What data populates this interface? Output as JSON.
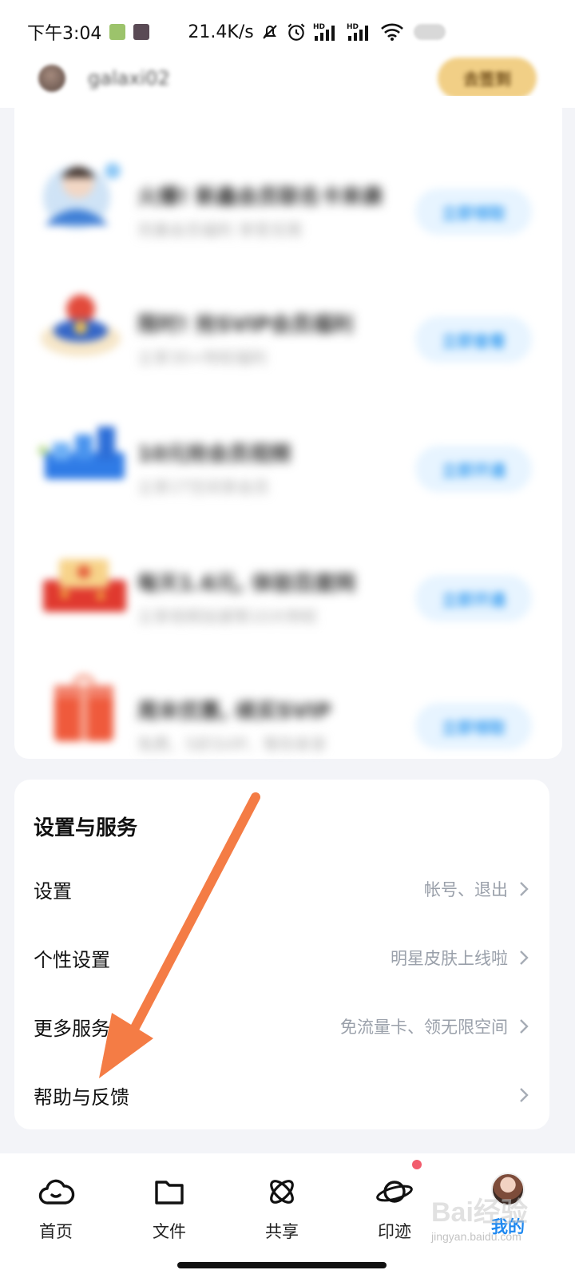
{
  "status_bar": {
    "time": "下午3:04",
    "net_speed": "21.4K/s"
  },
  "profile": {
    "username": "galaxi02",
    "sign_in_button": "去签到"
  },
  "promos": [
    {
      "title": "火爆! 新鑫会员联名卡来袭",
      "subtitle": "完善会员福利 享受无限",
      "button": "立即领取"
    },
    {
      "title": "限时! 抢SVIP会员福利",
      "subtitle": "立享30+特权福利",
      "button": "立即查看"
    },
    {
      "title": "10元抢会员视频",
      "subtitle": "立享1T空间享会员",
      "button": "立即开通"
    },
    {
      "title": "每天1.6元, 体验百度网",
      "subtitle": "立享视频加速等10大特权",
      "button": "立即开通"
    },
    {
      "title": "周末优惠, 续买SVIP",
      "subtitle": "免费、5折SVIP、等你来享",
      "button": "立即领取"
    }
  ],
  "settings": {
    "title": "设置与服务",
    "rows": [
      {
        "label": "设置",
        "hint": "帐号、退出"
      },
      {
        "label": "个性设置",
        "hint": "明星皮肤上线啦"
      },
      {
        "label": "更多服务",
        "hint": "免流量卡、领无限空间"
      },
      {
        "label": "帮助与反馈",
        "hint": ""
      }
    ]
  },
  "nav": {
    "items": [
      {
        "label": "首页",
        "icon": "cloud-icon"
      },
      {
        "label": "文件",
        "icon": "folder-icon"
      },
      {
        "label": "共享",
        "icon": "atom-icon"
      },
      {
        "label": "印迹",
        "icon": "planet-icon"
      },
      {
        "label": "我的",
        "icon": "avatar"
      }
    ],
    "active_index": 4,
    "badge_on": "印迹"
  },
  "annotation": {
    "arrow_color": "#f47c45",
    "points_to": "帮助与反馈"
  },
  "watermark": {
    "logo": "Bai经验",
    "url": "jingyan.baidu.com"
  },
  "colors": {
    "accent": "#1e88f0",
    "hint_text": "#9aa0aa",
    "sign_in": "#f1cf86",
    "badge": "#f25c6d"
  }
}
